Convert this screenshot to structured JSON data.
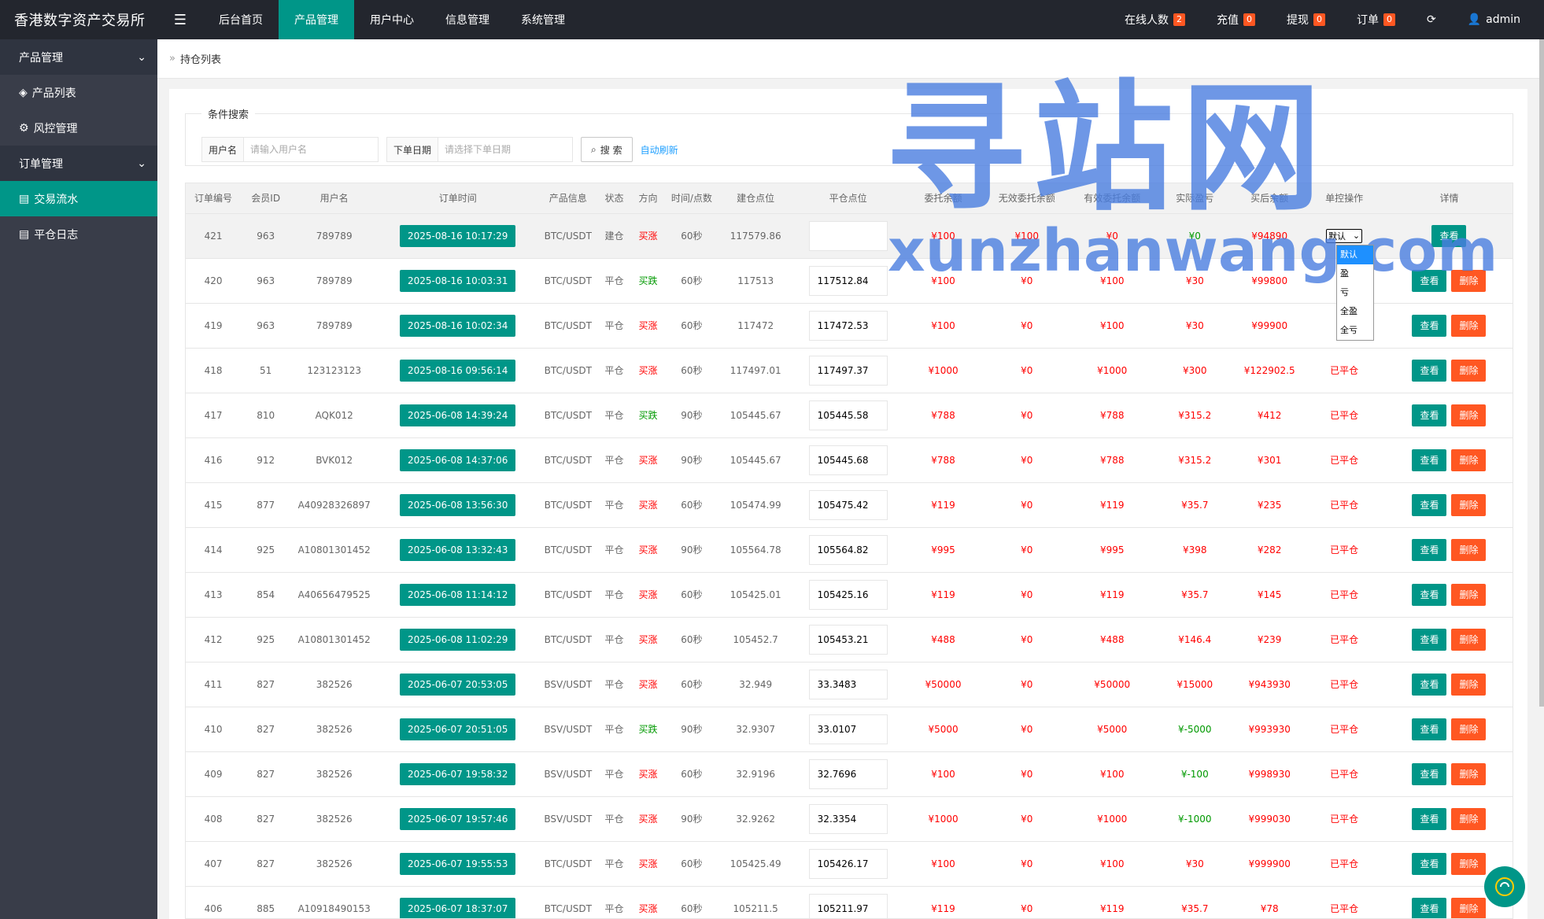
{
  "app": {
    "title": "香港数字资产交易所"
  },
  "topnav": [
    {
      "label": "后台首页",
      "active": false
    },
    {
      "label": "产品管理",
      "active": true
    },
    {
      "label": "用户中心",
      "active": false
    },
    {
      "label": "信息管理",
      "active": false
    },
    {
      "label": "系统管理",
      "active": false
    }
  ],
  "topright": [
    {
      "label": "在线人数",
      "badge": "2"
    },
    {
      "label": "充值",
      "badge": "0"
    },
    {
      "label": "提现",
      "badge": "0"
    },
    {
      "label": "订单",
      "badge": "0"
    }
  ],
  "user": {
    "name": "admin"
  },
  "sidebar": {
    "group1": "产品管理",
    "items1": [
      "产品列表",
      "风控管理"
    ],
    "group2": "订单管理",
    "items2": [
      {
        "label": "交易流水",
        "active": true
      },
      {
        "label": "平仓日志",
        "active": false
      }
    ]
  },
  "breadcrumb": "持仓列表",
  "search": {
    "legend": "条件搜索",
    "username_label": "用户名",
    "username_placeholder": "请输入用户名",
    "date_label": "下单日期",
    "date_placeholder": "请选择下单日期",
    "search_button": "搜 索",
    "auto_refresh": "自动刷新"
  },
  "table": {
    "headers": [
      "订单编号",
      "会员ID",
      "用户名",
      "订单时间",
      "产品信息",
      "状态",
      "方向",
      "时间/点数",
      "建仓点位",
      "平仓点位",
      "委托余额",
      "无效委托余额",
      "有效委托余额",
      "实际盈亏",
      "买后余额",
      "单控操作",
      "详情"
    ],
    "rows": [
      {
        "id": "421",
        "member": "963",
        "user": "789789",
        "time": "2025-08-16 10:17:29",
        "product": "BTC/USDT",
        "status": "建仓",
        "dir": "买涨",
        "dur": "60秒",
        "open": "117579.86",
        "close": "",
        "amount": "¥100",
        "invalid": "¥100",
        "valid": "¥0",
        "pl": "¥0",
        "after": "¥94890",
        "ctrl": "select",
        "hl": true
      },
      {
        "id": "420",
        "member": "963",
        "user": "789789",
        "time": "2025-08-16 10:03:31",
        "product": "BTC/USDT",
        "status": "平仓",
        "dir": "买跌",
        "dur": "60秒",
        "open": "117513",
        "close": "117512.84",
        "amount": "¥100",
        "invalid": "¥0",
        "valid": "¥100",
        "pl": "¥30",
        "after": "¥99800",
        "ctrl": ""
      },
      {
        "id": "419",
        "member": "963",
        "user": "789789",
        "time": "2025-08-16 10:02:34",
        "product": "BTC/USDT",
        "status": "平仓",
        "dir": "买涨",
        "dur": "60秒",
        "open": "117472",
        "close": "117472.53",
        "amount": "¥100",
        "invalid": "¥0",
        "valid": "¥100",
        "pl": "¥30",
        "after": "¥99900",
        "ctrl": ""
      },
      {
        "id": "418",
        "member": "51",
        "user": "123123123",
        "time": "2025-08-16 09:56:14",
        "product": "BTC/USDT",
        "status": "平仓",
        "dir": "买涨",
        "dur": "60秒",
        "open": "117497.01",
        "close": "117497.37",
        "amount": "¥1000",
        "invalid": "¥0",
        "valid": "¥1000",
        "pl": "¥300",
        "after": "¥122902.5",
        "ctrl": "已平仓"
      },
      {
        "id": "417",
        "member": "810",
        "user": "AQK012",
        "time": "2025-06-08 14:39:24",
        "product": "BTC/USDT",
        "status": "平仓",
        "dir": "买跌",
        "dur": "90秒",
        "open": "105445.67",
        "close": "105445.58",
        "amount": "¥788",
        "invalid": "¥0",
        "valid": "¥788",
        "pl": "¥315.2",
        "after": "¥412",
        "ctrl": "已平仓"
      },
      {
        "id": "416",
        "member": "912",
        "user": "BVK012",
        "time": "2025-06-08 14:37:06",
        "product": "BTC/USDT",
        "status": "平仓",
        "dir": "买涨",
        "dur": "90秒",
        "open": "105445.67",
        "close": "105445.68",
        "amount": "¥788",
        "invalid": "¥0",
        "valid": "¥788",
        "pl": "¥315.2",
        "after": "¥301",
        "ctrl": "已平仓"
      },
      {
        "id": "415",
        "member": "877",
        "user": "A40928326897",
        "time": "2025-06-08 13:56:30",
        "product": "BTC/USDT",
        "status": "平仓",
        "dir": "买涨",
        "dur": "60秒",
        "open": "105474.99",
        "close": "105475.42",
        "amount": "¥119",
        "invalid": "¥0",
        "valid": "¥119",
        "pl": "¥35.7",
        "after": "¥235",
        "ctrl": "已平仓"
      },
      {
        "id": "414",
        "member": "925",
        "user": "A10801301452",
        "time": "2025-06-08 13:32:43",
        "product": "BTC/USDT",
        "status": "平仓",
        "dir": "买涨",
        "dur": "90秒",
        "open": "105564.78",
        "close": "105564.82",
        "amount": "¥995",
        "invalid": "¥0",
        "valid": "¥995",
        "pl": "¥398",
        "after": "¥282",
        "ctrl": "已平仓"
      },
      {
        "id": "413",
        "member": "854",
        "user": "A40656479525",
        "time": "2025-06-08 11:14:12",
        "product": "BTC/USDT",
        "status": "平仓",
        "dir": "买涨",
        "dur": "60秒",
        "open": "105425.01",
        "close": "105425.16",
        "amount": "¥119",
        "invalid": "¥0",
        "valid": "¥119",
        "pl": "¥35.7",
        "after": "¥145",
        "ctrl": "已平仓"
      },
      {
        "id": "412",
        "member": "925",
        "user": "A10801301452",
        "time": "2025-06-08 11:02:29",
        "product": "BTC/USDT",
        "status": "平仓",
        "dir": "买涨",
        "dur": "60秒",
        "open": "105452.7",
        "close": "105453.21",
        "amount": "¥488",
        "invalid": "¥0",
        "valid": "¥488",
        "pl": "¥146.4",
        "after": "¥239",
        "ctrl": "已平仓"
      },
      {
        "id": "411",
        "member": "827",
        "user": "382526",
        "time": "2025-06-07 20:53:05",
        "product": "BSV/USDT",
        "status": "平仓",
        "dir": "买涨",
        "dur": "60秒",
        "open": "32.949",
        "close": "33.3483",
        "amount": "¥50000",
        "invalid": "¥0",
        "valid": "¥50000",
        "pl": "¥15000",
        "after": "¥943930",
        "ctrl": "已平仓"
      },
      {
        "id": "410",
        "member": "827",
        "user": "382526",
        "time": "2025-06-07 20:51:05",
        "product": "BSV/USDT",
        "status": "平仓",
        "dir": "买跌",
        "dur": "90秒",
        "open": "32.9307",
        "close": "33.0107",
        "amount": "¥5000",
        "invalid": "¥0",
        "valid": "¥5000",
        "pl": "¥-5000",
        "after": "¥993930",
        "ctrl": "已平仓"
      },
      {
        "id": "409",
        "member": "827",
        "user": "382526",
        "time": "2025-06-07 19:58:32",
        "product": "BSV/USDT",
        "status": "平仓",
        "dir": "买涨",
        "dur": "60秒",
        "open": "32.9196",
        "close": "32.7696",
        "amount": "¥100",
        "invalid": "¥0",
        "valid": "¥100",
        "pl": "¥-100",
        "after": "¥998930",
        "ctrl": "已平仓"
      },
      {
        "id": "408",
        "member": "827",
        "user": "382526",
        "time": "2025-06-07 19:57:46",
        "product": "BSV/USDT",
        "status": "平仓",
        "dir": "买涨",
        "dur": "90秒",
        "open": "32.9262",
        "close": "32.3354",
        "amount": "¥1000",
        "invalid": "¥0",
        "valid": "¥1000",
        "pl": "¥-1000",
        "after": "¥999030",
        "ctrl": "已平仓"
      },
      {
        "id": "407",
        "member": "827",
        "user": "382526",
        "time": "2025-06-07 19:55:53",
        "product": "BTC/USDT",
        "status": "平仓",
        "dir": "买涨",
        "dur": "60秒",
        "open": "105425.49",
        "close": "105426.17",
        "amount": "¥100",
        "invalid": "¥0",
        "valid": "¥100",
        "pl": "¥30",
        "after": "¥999900",
        "ctrl": "已平仓"
      },
      {
        "id": "406",
        "member": "885",
        "user": "A10918490153",
        "time": "2025-06-07 18:37:07",
        "product": "BTC/USDT",
        "status": "平仓",
        "dir": "买涨",
        "dur": "60秒",
        "open": "105211.5",
        "close": "105211.97",
        "amount": "¥119",
        "invalid": "¥0",
        "valid": "¥119",
        "pl": "¥35.7",
        "after": "¥78",
        "ctrl": "已平仓"
      }
    ]
  },
  "buttons": {
    "view": "查看",
    "delete": "删除"
  },
  "dropdown": {
    "selected": "默认",
    "options": [
      "默认",
      "盈",
      "亏",
      "全盈",
      "全亏"
    ]
  },
  "watermark": {
    "cn": "寻站网",
    "en": "xunzhanwang.com"
  },
  "colors": {
    "primary": "#009688",
    "danger": "#ff5722",
    "topbar": "#23262e",
    "sidebar": "#393d49",
    "up": "#ff0000",
    "down": "#009900"
  }
}
